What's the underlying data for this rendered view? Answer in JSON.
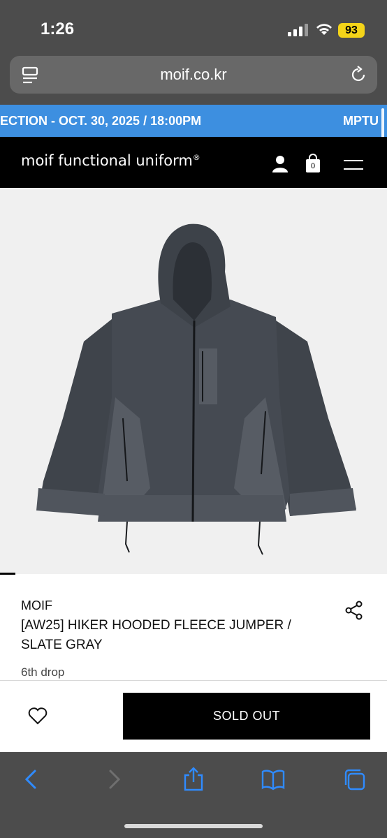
{
  "status_bar": {
    "time": "1:26",
    "battery": "93",
    "battery_color": "#f4d419"
  },
  "browser": {
    "url": "moif.co.kr",
    "icons": [
      "page-menu-icon",
      "reload-icon"
    ]
  },
  "announcement": {
    "left_text": "ECTION - OCT. 30, 2025 / 18:00PM",
    "right_text": "MPTU",
    "background": "#3d8fe0"
  },
  "site_header": {
    "brand": "moif functional uniform",
    "registered_mark": "®",
    "cart_count": "0",
    "icons": [
      "user-icon",
      "cart-icon",
      "menu-icon"
    ]
  },
  "product": {
    "brand": "MOIF",
    "title": "[AW25] HIKER HOODED FLEECE JUMPER / SLATE GRAY",
    "drop": "6th drop"
  },
  "buy_bar": {
    "sold_out_label": "SOLD OUT",
    "icons": [
      "heart-icon"
    ]
  },
  "toolbar": {
    "icons": [
      "back-icon",
      "forward-icon",
      "share-icon",
      "bookmarks-icon",
      "tabs-icon"
    ],
    "accent": "#2f8bff"
  }
}
